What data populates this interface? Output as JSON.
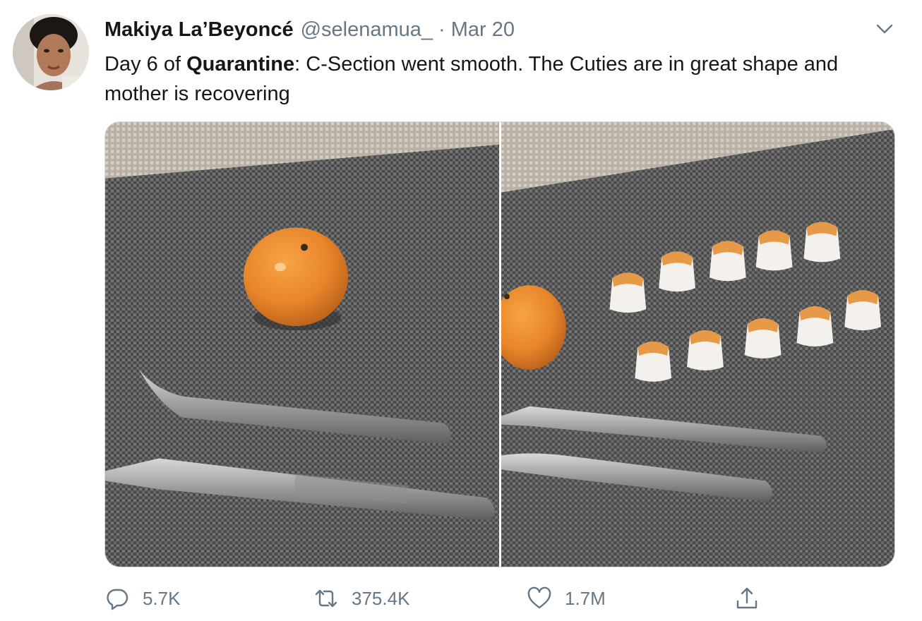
{
  "tweet": {
    "author": {
      "display_name": "Makiya La’Beyoncé",
      "handle": "@selenamua_",
      "avatar": "profile-photo"
    },
    "separator": "·",
    "date": "Mar 20",
    "menu_icon": "chevron-down-icon",
    "text": {
      "part1": "Day 6 of ",
      "bold": "Quarantine",
      "part2": ": C-Section went smooth. The Cuties are in great shape and mother is recovering"
    },
    "media": [
      {
        "description": "photo-whole-mandarin-orange-with-craft-knives"
      },
      {
        "description": "photo-mandarin-with-ten-wrapped-segments-and-knives"
      }
    ],
    "actions": {
      "reply": {
        "icon": "reply-icon",
        "count": "5.7K"
      },
      "retweet": {
        "icon": "retweet-icon",
        "count": "375.4K"
      },
      "like": {
        "icon": "heart-icon",
        "count": "1.7M"
      },
      "share": {
        "icon": "share-icon"
      }
    }
  },
  "colors": {
    "text_primary": "#14171a",
    "text_secondary": "#657786",
    "orange": "#e9892e",
    "mat": "#5a5a5a"
  }
}
